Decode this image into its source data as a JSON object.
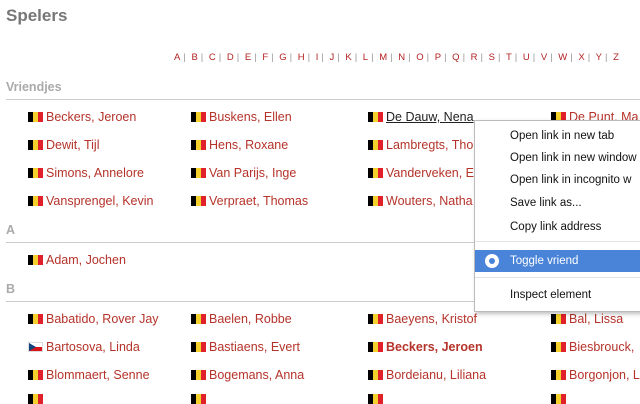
{
  "page": {
    "title": "Spelers"
  },
  "alphabet": [
    "A",
    "B",
    "C",
    "D",
    "E",
    "F",
    "G",
    "H",
    "I",
    "J",
    "K",
    "L",
    "M",
    "N",
    "O",
    "P",
    "Q",
    "R",
    "S",
    "T",
    "U",
    "V",
    "W",
    "X",
    "Y",
    "Z"
  ],
  "sections": {
    "vriendjes": {
      "title": "Vriendjes"
    },
    "a": {
      "title": "A"
    },
    "b": {
      "title": "B"
    }
  },
  "players": {
    "vriendjes": [
      "Beckers, Jeroen",
      "Buskens, Ellen",
      "De Dauw, Nena",
      "De Punt, Ma",
      "Dewit, Tijl",
      "Hens, Roxane",
      "Lambregts, Tho",
      "",
      "Simons, Annelore",
      "Van Parijs, Inge",
      "Vanderveken, E",
      "",
      "Vansprengel, Kevin",
      "Verpraet, Thomas",
      "Wouters, Natha",
      ""
    ],
    "a": [
      "Adam, Jochen"
    ],
    "b": [
      "Babatido, Rover Jay",
      "Baelen, Robbe",
      "Baeyens, Kristof",
      "Bal, Lissa",
      "Bartosova, Linda",
      "Bastiaens, Evert",
      "Beckers, Jeroen",
      "Biesbrouck,",
      "Blommaert, Senne",
      "Bogemans, Anna",
      "Bordeianu, Liliana",
      "Borgonjon, L"
    ]
  },
  "context_menu": {
    "items": [
      "Open link in new tab",
      "Open link in new window",
      "Open link in incognito w",
      "Save link as...",
      "Copy link address",
      "Toggle vriend",
      "Inspect element"
    ]
  },
  "colors": {
    "link": "#b5332a",
    "menu_highlight": "#4a84d8"
  }
}
